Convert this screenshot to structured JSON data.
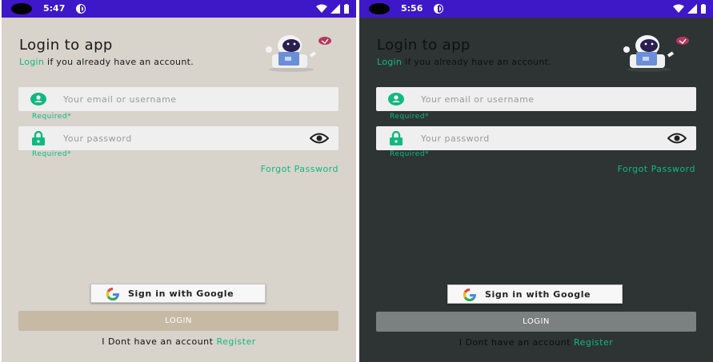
{
  "screens": [
    {
      "theme": "light",
      "status_bar": {
        "time": "5:47"
      },
      "title": "Login to app",
      "subtitle_link": "Login",
      "subtitle_rest": " if you already have an account.",
      "email": {
        "placeholder": "Your email or username",
        "helper": "Required*",
        "icon": "user-icon"
      },
      "password": {
        "placeholder": "Your password",
        "helper": "Required*",
        "icon": "lock-icon",
        "toggle_icon": "eye-icon"
      },
      "forgot_password": "Forgot Password",
      "google_button": "Sign in with Google",
      "login_button": "LOGIN",
      "register_prompt": "I Dont have an account ",
      "register_link": "Register",
      "colors": {
        "background": "#d8d3cb",
        "accent": "#10b981",
        "login_button": "#c6baa5",
        "status_bar": "#3d17c8"
      }
    },
    {
      "theme": "dark",
      "status_bar": {
        "time": "5:56"
      },
      "title": "Login to app",
      "subtitle_link": "Login",
      "subtitle_rest": " if you already have an account.",
      "email": {
        "placeholder": "Your email or username",
        "helper": "Required*",
        "icon": "user-icon"
      },
      "password": {
        "placeholder": "Your password",
        "helper": "Required*",
        "icon": "lock-icon",
        "toggle_icon": "eye-icon"
      },
      "forgot_password": "Forgot Password",
      "google_button": "Sign in with Google",
      "login_button": "LOGIN",
      "register_prompt": "I Dont have an account ",
      "register_link": "Register",
      "colors": {
        "background": "#2d3433",
        "accent": "#10b981",
        "login_button": "#7c8080",
        "status_bar": "#3d17c8"
      }
    }
  ]
}
